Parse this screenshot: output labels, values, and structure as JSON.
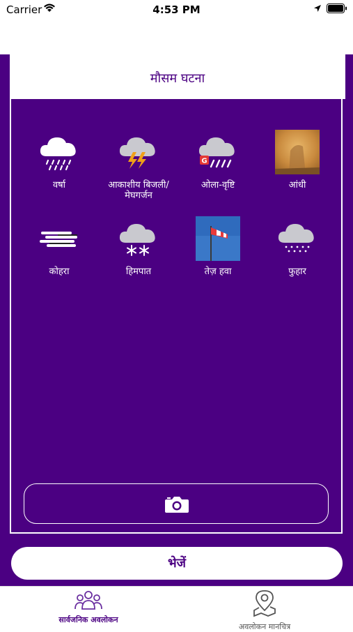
{
  "status_bar": {
    "carrier": "Carrier",
    "time": "4:53 PM"
  },
  "header": {
    "title": "मौसम घटना"
  },
  "phenomena": [
    {
      "label": "वर्षा",
      "icon": "rain-icon"
    },
    {
      "label": "आकाशीय बिजली/मेघगर्जन",
      "icon": "thunderstorm-icon"
    },
    {
      "label": "ओला-वृष्टि",
      "icon": "hail-icon"
    },
    {
      "label": "आंधी",
      "icon": "duststorm-photo"
    },
    {
      "label": "कोहरा",
      "icon": "fog-icon"
    },
    {
      "label": "हिमपात",
      "icon": "snow-icon"
    },
    {
      "label": "तेज़ हवा",
      "icon": "windsock-photo"
    },
    {
      "label": "फुहार",
      "icon": "drizzle-icon"
    }
  ],
  "camera_button": {
    "icon": "camera-icon"
  },
  "send_button": {
    "label": "भेजें"
  },
  "tabs": [
    {
      "label": "सार्वजनिक अवलोकन",
      "icon": "people-icon",
      "active": true
    },
    {
      "label": "अवलोकन मानचित्र",
      "icon": "map-pin-icon",
      "active": false
    }
  ],
  "colors": {
    "primary": "#4b0082",
    "background": "#ffffff"
  }
}
